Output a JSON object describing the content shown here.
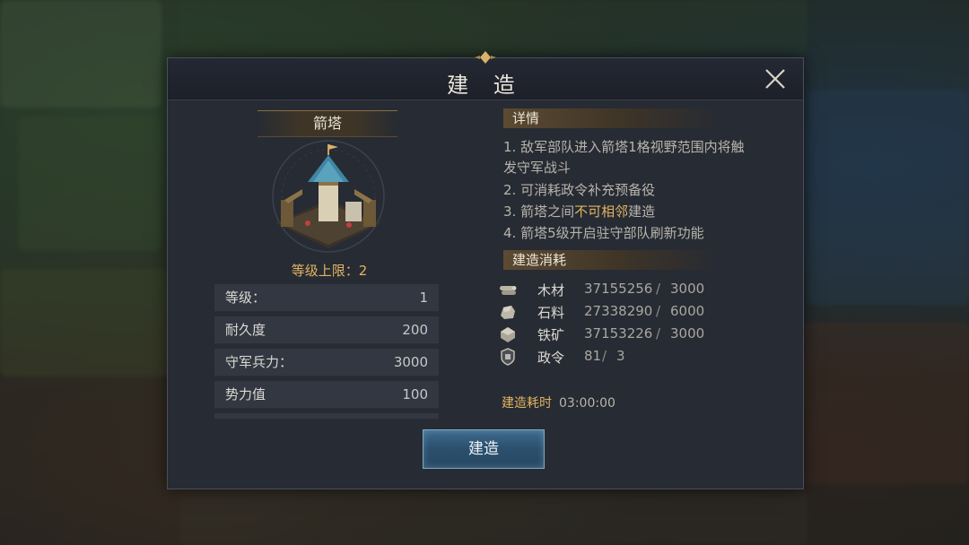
{
  "dialog": {
    "title": "建 造",
    "building_name": "箭塔",
    "level_limit_label": "等级上限：",
    "level_limit_value": "2",
    "stats": [
      {
        "label": "等级：",
        "value": "1"
      },
      {
        "label": "耐久度",
        "value": "200"
      },
      {
        "label": "守军兵力：",
        "value": "3000"
      },
      {
        "label": "势力值",
        "value": "100"
      }
    ],
    "details_header": "详情",
    "details": {
      "line1": "1. 敌军部队进入箭塔1格视野范围内将触",
      "line1b": "发守军战斗",
      "line2": "2. 可消耗政令补充预备役",
      "line3_pre": "3. 箭塔之间",
      "line3_hl": "不可相邻",
      "line3_post": "建造",
      "line4": "4. 箭塔5级开启驻守部队刷新功能"
    },
    "cost_header": "建造消耗",
    "costs": [
      {
        "icon": "wood-icon",
        "name": "木材",
        "have": "37155256",
        "sep": "/",
        "need": "3000"
      },
      {
        "icon": "stone-icon",
        "name": "石料",
        "have": "27338290",
        "sep": "/",
        "need": "6000"
      },
      {
        "icon": "iron-ore-icon",
        "name": "铁矿",
        "have": "37153226",
        "sep": "/",
        "need": "3000"
      },
      {
        "icon": "decree-icon",
        "name": "政令",
        "have": "81",
        "sep": "/",
        "need": "3"
      }
    ],
    "time_label": "建造耗时",
    "time_value": "03:00:00",
    "build_button": "建造"
  },
  "colors": {
    "accent_gold": "#e2b462",
    "button_blue": "#2b4f6d",
    "panel_bg": "#272b33"
  }
}
